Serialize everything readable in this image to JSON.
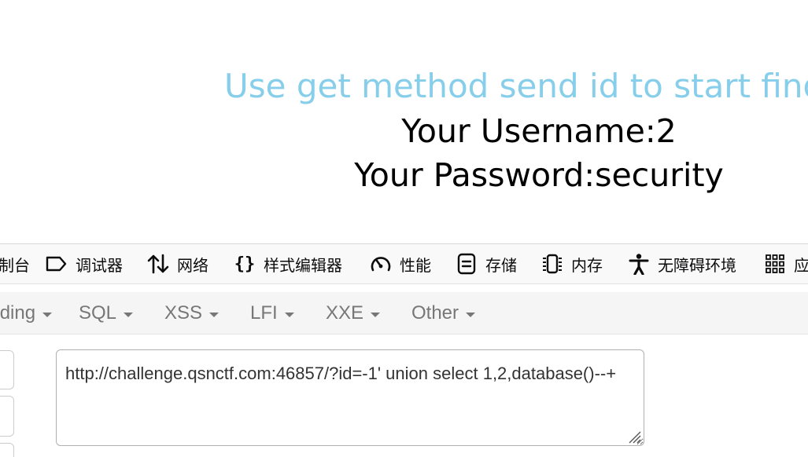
{
  "page": {
    "headline": "Use get method send id to start find flag",
    "username_line": "Your Username:2",
    "password_line": "Your Password:security"
  },
  "devtools": {
    "tabs": [
      {
        "label": "控制台",
        "icon": "console-icon"
      },
      {
        "label": "调试器",
        "icon": "debugger-icon"
      },
      {
        "label": "网络",
        "icon": "network-icon"
      },
      {
        "label": "样式编辑器",
        "icon": "style-editor-icon"
      },
      {
        "label": "性能",
        "icon": "performance-icon"
      },
      {
        "label": "存储",
        "icon": "storage-icon"
      },
      {
        "label": "内存",
        "icon": "memory-icon"
      },
      {
        "label": "无障碍环境",
        "icon": "accessibility-icon"
      },
      {
        "label": "应用程序",
        "icon": "application-icon"
      }
    ]
  },
  "hackbar": {
    "menus": [
      "Encoding",
      "SQL",
      "XSS",
      "LFI",
      "XXE",
      "Other"
    ],
    "url": "http://challenge.qsnctf.com:46857/?id=-1' union select 1,2,database()--+"
  },
  "colors": {
    "headline": "#87ceeb",
    "devtools_bg": "#f9f9fa",
    "hackbar_menu_bg": "#f5f5f5",
    "menu_text": "#777777"
  }
}
